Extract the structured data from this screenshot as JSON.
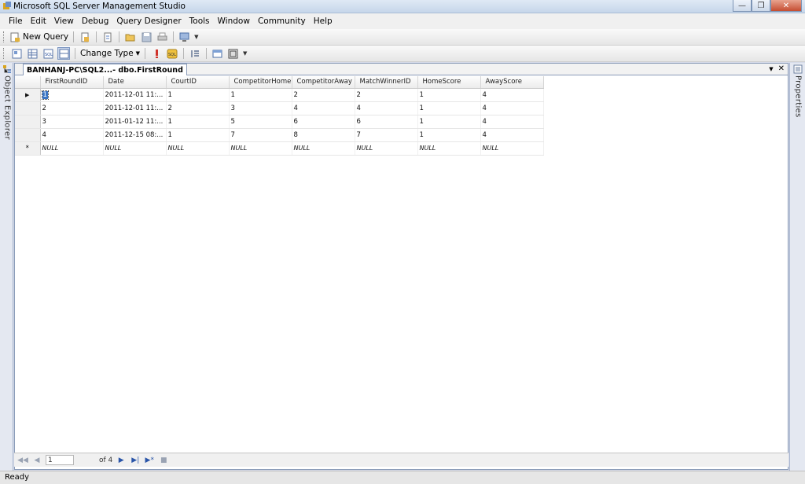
{
  "window": {
    "title": "Microsoft SQL Server Management Studio"
  },
  "menu": [
    "File",
    "Edit",
    "View",
    "Debug",
    "Query Designer",
    "Tools",
    "Window",
    "Community",
    "Help"
  ],
  "toolbar1": {
    "new_query_label": "New Query"
  },
  "toolbar2": {
    "change_type_label": "Change Type"
  },
  "doc_tab": {
    "label": "BANHANJ-PC\\SQL2...- dbo.FirstRound"
  },
  "left_panel": {
    "label": "Object Explorer"
  },
  "right_panel": {
    "label": "Properties"
  },
  "grid": {
    "columns": [
      "FirstRoundID",
      "Date",
      "CourtID",
      "CompetitorHome",
      "CompetitorAway",
      "MatchWinnerID",
      "HomeScore",
      "AwayScore"
    ],
    "rows": [
      [
        "1",
        "2011-12-01 11:...",
        "1",
        "1",
        "2",
        "2",
        "1",
        "4"
      ],
      [
        "2",
        "2011-12-01 11:...",
        "2",
        "3",
        "4",
        "4",
        "1",
        "4"
      ],
      [
        "3",
        "2011-01-12 11:...",
        "1",
        "5",
        "6",
        "6",
        "1",
        "4"
      ],
      [
        "4",
        "2011-12-15 08:...",
        "1",
        "7",
        "8",
        "7",
        "1",
        "4"
      ]
    ],
    "new_row": [
      "NULL",
      "NULL",
      "NULL",
      "NULL",
      "NULL",
      "NULL",
      "NULL",
      "NULL"
    ],
    "new_row_marker": "*"
  },
  "navigator": {
    "current": "1",
    "of_label": "of 4"
  },
  "status": {
    "text": "Ready"
  }
}
